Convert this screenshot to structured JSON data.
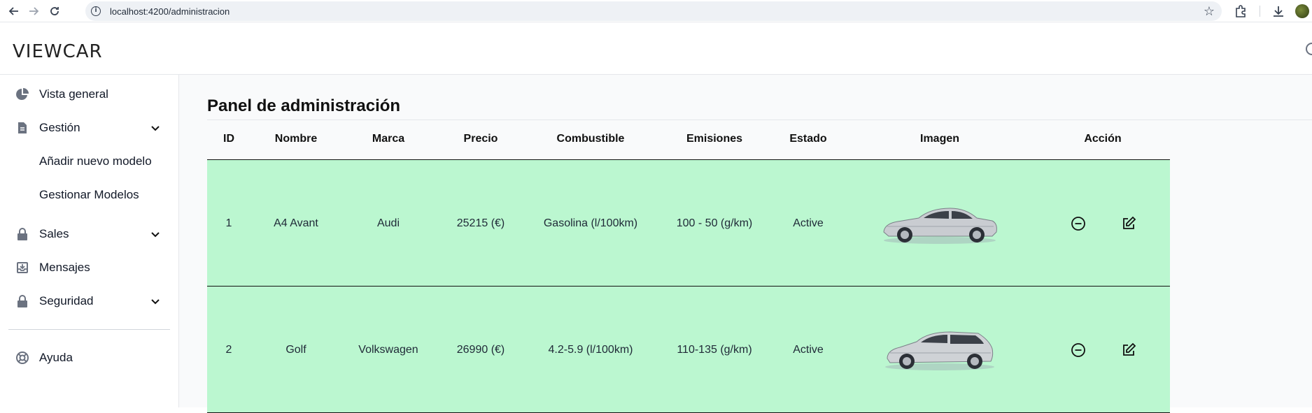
{
  "browser": {
    "url": "localhost:4200/administracion"
  },
  "app": {
    "logo": "VIEWCAR"
  },
  "sidebar": {
    "items": [
      {
        "label": "Vista general",
        "icon": "pie-chart-icon"
      },
      {
        "label": "Gestión",
        "icon": "document-icon",
        "expandable": true
      },
      {
        "label": "Añadir nuevo modelo",
        "sub": true
      },
      {
        "label": "Gestionar Modelos",
        "sub": true
      },
      {
        "label": "Sales",
        "icon": "lock-icon",
        "expandable": true
      },
      {
        "label": "Mensajes",
        "icon": "inbox-icon"
      },
      {
        "label": "Seguridad",
        "icon": "lock-icon",
        "expandable": true
      },
      {
        "label": "Ayuda",
        "icon": "lifebuoy-icon"
      }
    ]
  },
  "main": {
    "title": "Panel de administración",
    "table": {
      "headers": [
        "ID",
        "Nombre",
        "Marca",
        "Precio",
        "Combustible",
        "Emisiones",
        "Estado",
        "Imagen",
        "Acción"
      ],
      "rows": [
        {
          "id": "1",
          "nombre": "A4 Avant",
          "marca": "Audi",
          "precio": "25215 (€)",
          "combustible": "Gasolina (l/100km)",
          "emisiones": "100 - 50 (g/km)",
          "estado": "Active",
          "imagen": "sedan-car-image"
        },
        {
          "id": "2",
          "nombre": "Golf",
          "marca": "Volkswagen",
          "precio": "26990 (€)",
          "combustible": "4.2-5.9 (l/100km)",
          "emisiones": "110-135 (g/km)",
          "estado": "Active",
          "imagen": "hatchback-car-image"
        }
      ]
    }
  },
  "colors": {
    "row_background": "#bbf7d0",
    "main_background": "#f9fafb"
  }
}
